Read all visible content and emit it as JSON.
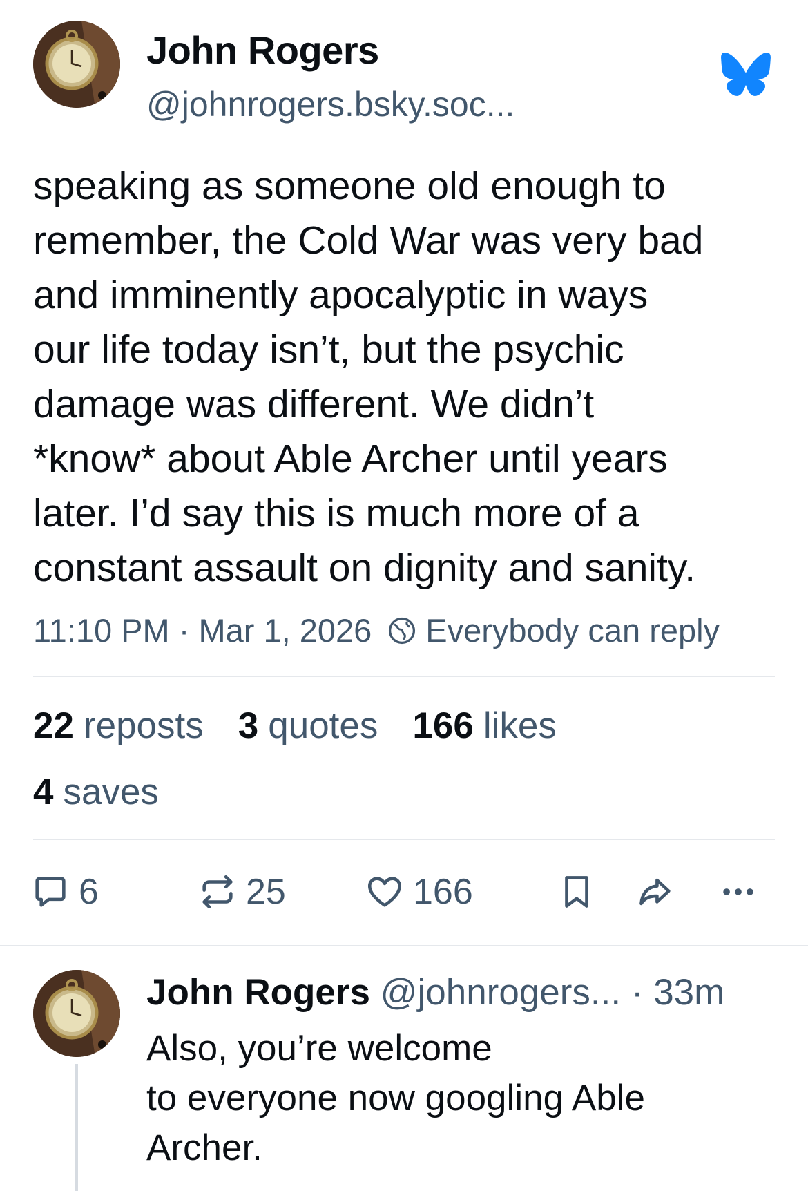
{
  "post": {
    "author_name": "John Rogers",
    "author_handle": "@johnrogers.bsky.soc...",
    "avatar_icon": "pocket-watch-avatar",
    "brand_icon": "bluesky-butterfly-icon",
    "brand_color": "#1185fe",
    "text": "speaking as someone old enough to\nremember, the Cold War was very bad\nand imminently apocalyptic in ways\nour life today isn’t, but the psychic\ndamage was different. We didn’t\n*know* about Able Archer until years\nlater. I’d say this is much more of a\nconstant assault on dignity and sanity.",
    "timestamp": "11:10 PM · Mar 1, 2026",
    "reply_setting_icon": "globe-icon",
    "reply_setting": "Everybody can reply"
  },
  "stats": {
    "reposts_count": "22",
    "reposts_label": "reposts",
    "quotes_count": "3",
    "quotes_label": "quotes",
    "likes_count": "166",
    "likes_label": "likes",
    "saves_count": "4",
    "saves_label": "saves"
  },
  "actions": {
    "reply_count": "6",
    "repost_count": "25",
    "like_count": "166"
  },
  "reply": {
    "author_name": "John Rogers",
    "author_handle": "@johnrogers...",
    "time": " · 33m",
    "text": "Also, you’re welcome\nto everyone now googling Able\nArcher."
  }
}
